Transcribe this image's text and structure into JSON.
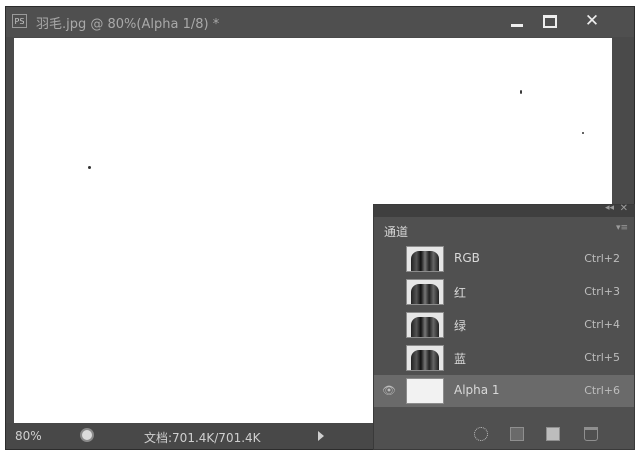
{
  "window": {
    "app_icon": "PS",
    "title": "羽毛.jpg @ 80%(Alpha 1/8) *",
    "minimize_icon": "minimize-icon",
    "maximize_icon": "maximize-icon",
    "close_icon": "close-icon"
  },
  "status": {
    "zoom": "80%",
    "doc_info": "文档:701.4K/701.4K"
  },
  "channels_panel": {
    "tab_label": "通道",
    "channels": [
      {
        "name": "RGB",
        "shortcut": "Ctrl+2",
        "visible": false,
        "selected": false
      },
      {
        "name": "红",
        "shortcut": "Ctrl+3",
        "visible": false,
        "selected": false
      },
      {
        "name": "绿",
        "shortcut": "Ctrl+4",
        "visible": false,
        "selected": false
      },
      {
        "name": "蓝",
        "shortcut": "Ctrl+5",
        "visible": false,
        "selected": false
      },
      {
        "name": "Alpha 1",
        "shortcut": "Ctrl+6",
        "visible": true,
        "selected": true
      }
    ]
  },
  "colors": {
    "chrome": "#4a4a4a",
    "panel": "#505050",
    "selected_row": "#6a6a6a",
    "canvas": "#ffffff"
  }
}
